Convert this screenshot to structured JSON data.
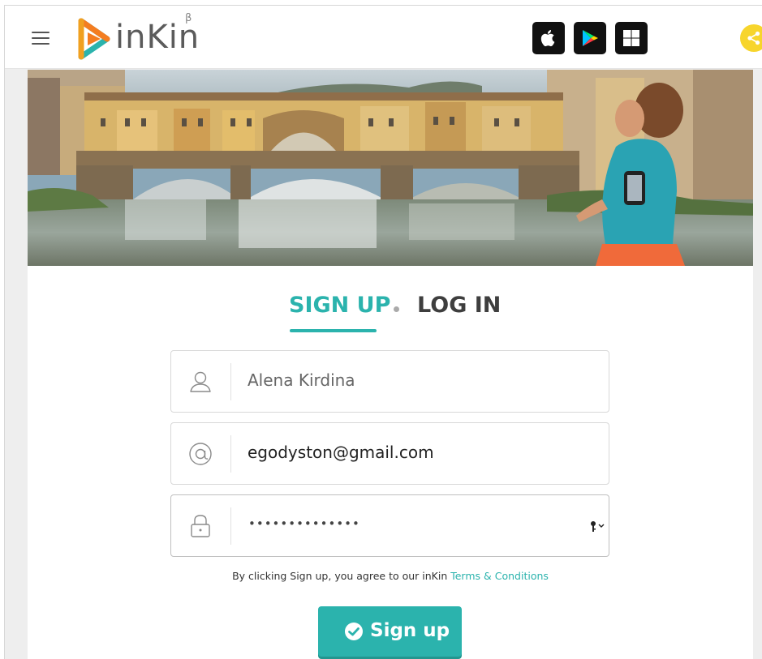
{
  "header": {
    "logo_text": "inKin",
    "logo_beta": "β",
    "stores": [
      "apple-store",
      "google-play",
      "windows-store"
    ],
    "icons": [
      "hamburger-menu-icon",
      "apple-icon",
      "play-store-icon",
      "windows-icon",
      "share-icon"
    ],
    "brand_colors": {
      "teal": "#2bb3ad",
      "orange": "#f47d20",
      "share": "#f7d52c"
    }
  },
  "tabs": {
    "signup_label": "SIGN UP",
    "login_label": "LOG IN",
    "active": "SIGN UP"
  },
  "form": {
    "name_value": "Alena Kirdina",
    "email_value": "egodyston@gmail.com",
    "password_masked": "••••••••••••••",
    "icons": [
      "user-icon",
      "at-icon",
      "lock-icon",
      "key-icon"
    ]
  },
  "terms": {
    "text": "By clicking Sign up, you agree to our inKin ",
    "link": "Terms & Conditions"
  },
  "submit": {
    "label": "Sign up"
  }
}
